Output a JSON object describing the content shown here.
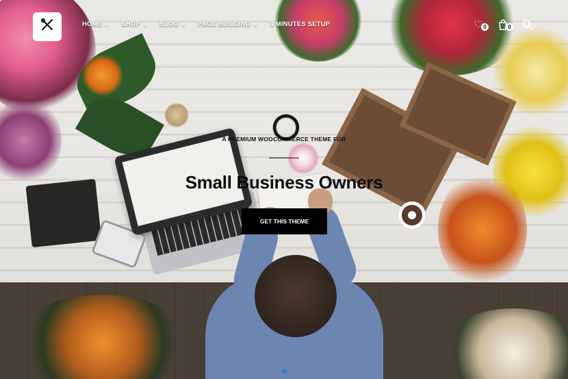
{
  "header": {
    "logo_icon": "crossed-tools-icon",
    "nav": [
      {
        "label": "HOME",
        "has_dropdown": true
      },
      {
        "label": "SHOP",
        "has_dropdown": true
      },
      {
        "label": "BLOG",
        "has_dropdown": true
      },
      {
        "label": "PAGE BUILDING",
        "has_dropdown": true
      },
      {
        "label": "3 MINUTES SETUP",
        "has_dropdown": false
      }
    ],
    "wishlist_count": "0",
    "cart_count": "0"
  },
  "hero": {
    "subtitle": "A PREMIUM WOOCOMMERCE THEME FOR",
    "headline": "Small Business Owners",
    "cta_label": "GET THIS THEME",
    "slides": 1,
    "active_slide": 1
  },
  "colors": {
    "cta_background": "#000000",
    "cta_text": "#ffffff",
    "active_dot": "#2d7fd3"
  }
}
